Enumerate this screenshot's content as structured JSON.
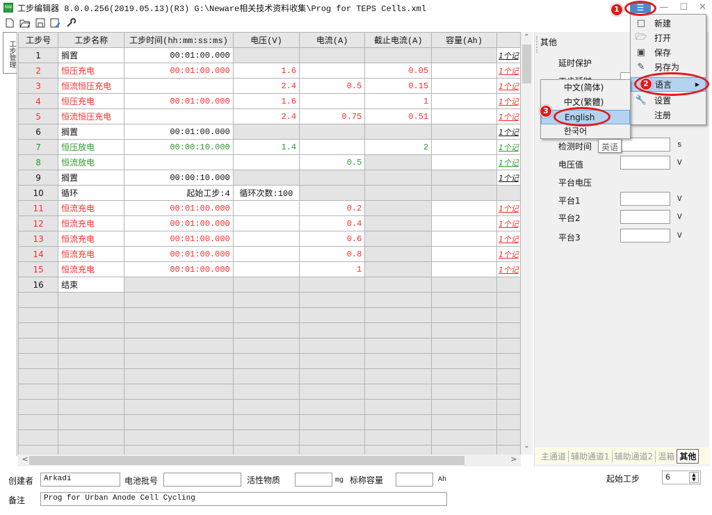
{
  "window": {
    "app_icon_label": "NW",
    "title": "工步编辑器 8.0.0.256(2019.05.13)(R3) G:\\Neware相关技术资料收集\\Prog for TEPS Cells.xml",
    "menu_icon": "☰",
    "minimize": "—",
    "maximize": "☐",
    "close": "✕"
  },
  "toolbar": {
    "new_icon": "new-file",
    "open_icon": "open-folder",
    "save_icon": "save",
    "saveas_icon": "save-as",
    "settings_icon": "wrench"
  },
  "side_tab": {
    "label": "工步管理"
  },
  "grid": {
    "columns": [
      "工步号",
      "工步名称",
      "工步时间(hh:mm:ss:ms)",
      "电压(V)",
      "电流(A)",
      "截止电流(A)",
      "容量(Ah)",
      ""
    ],
    "rows": [
      {
        "no": "1",
        "name": "搁置",
        "time": "00:01:00.000",
        "v": "",
        "a": "",
        "cut": "",
        "cap": "",
        "link": "1个记",
        "color": "black"
      },
      {
        "no": "2",
        "name": "恒压充电",
        "time": "00:01:00.000",
        "v": "1.6",
        "a": "",
        "cut": "0.05",
        "cap": "",
        "link": "1个记",
        "color": "red"
      },
      {
        "no": "3",
        "name": "恒流恒压充电",
        "time": "",
        "v": "2.4",
        "a": "0.5",
        "cut": "0.15",
        "cap": "",
        "link": "1个记",
        "color": "red"
      },
      {
        "no": "4",
        "name": "恒压充电",
        "time": "00:01:00.000",
        "v": "1.6",
        "a": "",
        "cut": "1",
        "cap": "",
        "link": "1个记",
        "color": "red"
      },
      {
        "no": "5",
        "name": "恒流恒压充电",
        "time": "",
        "v": "2.4",
        "a": "0.75",
        "cut": "0.51",
        "cap": "",
        "link": "1个记",
        "color": "red"
      },
      {
        "no": "6",
        "name": "搁置",
        "time": "00:01:00.000",
        "v": "",
        "a": "",
        "cut": "",
        "cap": "",
        "link": "1个记",
        "color": "black"
      },
      {
        "no": "7",
        "name": "恒压放电",
        "time": "00:00:10.000",
        "v": "1.4",
        "a": "",
        "cut": "2",
        "cap": "",
        "link": "1个记",
        "color": "green"
      },
      {
        "no": "8",
        "name": "恒流放电",
        "time": "",
        "v": "",
        "a": "0.5",
        "cut": "",
        "cap": "",
        "link": "1个记",
        "color": "green"
      },
      {
        "no": "9",
        "name": "搁置",
        "time": "00:00:10.000",
        "v": "",
        "a": "",
        "cut": "",
        "cap": "",
        "link": "1个记",
        "color": "black"
      },
      {
        "no": "10",
        "name": "循环",
        "time": "起始工步:4",
        "v": "循环次数:100",
        "a": "",
        "cut": "",
        "cap": "",
        "link": "",
        "color": "black"
      },
      {
        "no": "11",
        "name": "恒流充电",
        "time": "00:01:00.000",
        "v": "",
        "a": "0.2",
        "cut": "",
        "cap": "",
        "link": "1个记",
        "color": "red"
      },
      {
        "no": "12",
        "name": "恒流充电",
        "time": "00:01:00.000",
        "v": "",
        "a": "0.4",
        "cut": "",
        "cap": "",
        "link": "1个记",
        "color": "red"
      },
      {
        "no": "13",
        "name": "恒流充电",
        "time": "00:01:00.000",
        "v": "",
        "a": "0.6",
        "cut": "",
        "cap": "",
        "link": "1个记",
        "color": "red"
      },
      {
        "no": "14",
        "name": "恒流充电",
        "time": "00:01:00.000",
        "v": "",
        "a": "0.8",
        "cut": "",
        "cap": "",
        "link": "1个记",
        "color": "red"
      },
      {
        "no": "15",
        "name": "恒流充电",
        "time": "00:01:00.000",
        "v": "",
        "a": "1",
        "cut": "",
        "cap": "",
        "link": "1个记",
        "color": "red"
      },
      {
        "no": "16",
        "name": "结束",
        "time": "",
        "v": "",
        "a": "",
        "cut": "",
        "cap": "",
        "link": "",
        "color": "black"
      }
    ],
    "empty_rows": 11,
    "colors": {
      "red": "#ff2a2a",
      "green": "#2a9a2a",
      "black": "#111111"
    }
  },
  "right_panel": {
    "title": "其他",
    "delay_protect": "延时保护",
    "step_delay": "工步延时",
    "detect_time": "检测时间",
    "detect_time_unit": "s",
    "voltage_value": "电压值",
    "voltage_value_unit": "V",
    "platform_voltage": "平台电压",
    "platform1": "平台1",
    "platform2": "平台2",
    "platform3": "平台3",
    "platform_unit": "V",
    "tabs": [
      "主通道",
      "辅助通道1",
      "辅助通道2",
      "温箱",
      "其他"
    ],
    "active_tab": "其他"
  },
  "bottom": {
    "creator_label": "创建者",
    "creator_value": "Arkadi",
    "batch_label": "电池批号",
    "batch_value": "",
    "active_label": "活性物质",
    "active_value": "",
    "active_unit": "mg",
    "capacity_label": "标称容量",
    "capacity_value": "",
    "capacity_unit": "Ah",
    "start_step_label": "起始工步",
    "start_step_value": "6",
    "remark_label": "备注",
    "remark_value": "Prog for Urban Anode Cell Cycling"
  },
  "main_menu": {
    "items": [
      {
        "icon": "new-file",
        "label": "新建"
      },
      {
        "icon": "open-folder",
        "label": "打开"
      },
      {
        "icon": "save",
        "label": "保存"
      },
      {
        "icon": "save-as",
        "label": "另存为"
      },
      {
        "icon": "",
        "label": "语言",
        "submenu": true,
        "highlighted": true
      },
      {
        "icon": "wrench",
        "label": "设置"
      },
      {
        "icon": "",
        "label": "注册"
      }
    ]
  },
  "language_menu": {
    "items": [
      {
        "label": "中文(简体)"
      },
      {
        "label": "中文(繁體)"
      },
      {
        "label": "English",
        "highlighted": true
      },
      {
        "label": "한국어"
      }
    ]
  },
  "tooltip": {
    "text": "英语"
  },
  "annotations": {
    "step1": "1",
    "step2": "2",
    "step3": "3",
    "color": "#e01a1a"
  }
}
